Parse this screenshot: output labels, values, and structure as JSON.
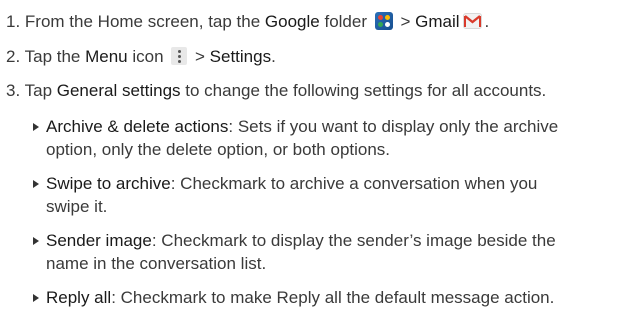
{
  "steps": [
    {
      "number": "1.",
      "text_1": "From the Home screen, tap the ",
      "bold_1": "Google",
      "text_2": " folder ",
      "text_3": " > ",
      "bold_2": "Gmail",
      "text_4": "."
    },
    {
      "number": "2.",
      "text_1": "Tap the ",
      "bold_1": "Menu",
      "text_2": " icon ",
      "text_3": " > ",
      "bold_2": "Settings",
      "text_4": "."
    },
    {
      "number": "3.",
      "text_1": "Tap ",
      "bold_1": "General settings",
      "text_2": " to change the following settings for all accounts."
    }
  ],
  "bullets": [
    {
      "term": "Archive & delete actions",
      "line_1": ": Sets if you want to display only the archive",
      "line_2": "option, only the delete option, or both options."
    },
    {
      "term": "Swipe to archive",
      "line_1": ": Checkmark to archive a conversation when you",
      "line_2": "swipe it."
    },
    {
      "term": "Sender image",
      "line_1": ": Checkmark to display the sender’s image beside the",
      "line_2": "name in the conversation list."
    },
    {
      "term": "Reply all",
      "line_1": ": Checkmark to make Reply all the default message action.",
      "line_2": ""
    }
  ],
  "icons": {
    "google_folder": "google-folder-icon",
    "gmail": "gmail-icon",
    "menu": "menu-icon"
  },
  "colors": {
    "text": "#3a3a3a",
    "folder_blue": "#2a6fb8",
    "gmail_red": "#d93a2b"
  }
}
